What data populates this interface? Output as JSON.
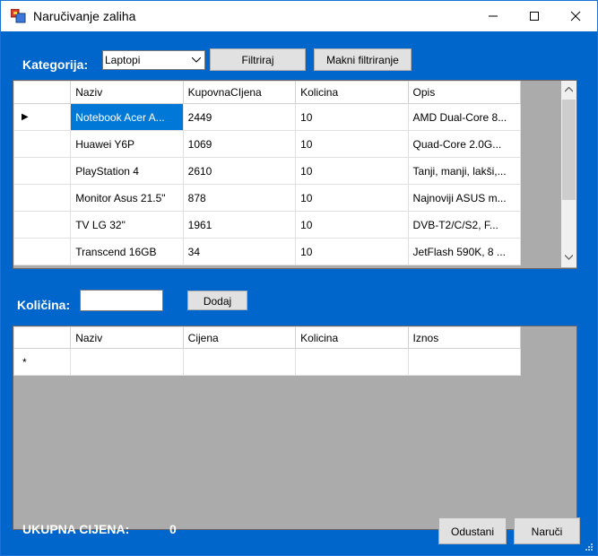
{
  "window": {
    "title": "Naručivanje zaliha"
  },
  "filter": {
    "category_label": "Kategorija:",
    "category_value": "Laptopi",
    "filter_button": "Filtriraj",
    "clear_filter_button": "Makni filtriranje"
  },
  "products": {
    "columns": [
      "Naziv",
      "KupovnaCIjena",
      "Kolicina",
      "Opis"
    ],
    "rows": [
      {
        "naziv": "Notebook Acer A...",
        "cijena": "2449",
        "kolicina": "10",
        "opis": "AMD Dual-Core 8..."
      },
      {
        "naziv": "Huawei Y6P",
        "cijena": "1069",
        "kolicina": "10",
        "opis": "Quad-Core 2.0G..."
      },
      {
        "naziv": "PlayStation 4",
        "cijena": "2610",
        "kolicina": "10",
        "opis": "Tanji, manji, lakši,..."
      },
      {
        "naziv": "Monitor Asus 21.5\"",
        "cijena": "878",
        "kolicina": "10",
        "opis": "Najnoviji ASUS m..."
      },
      {
        "naziv": "TV LG 32\"",
        "cijena": "1961",
        "kolicina": "10",
        "opis": "DVB-T2/C/S2, F..."
      },
      {
        "naziv": "Transcend 16GB",
        "cijena": "34",
        "kolicina": "10",
        "opis": "JetFlash 590K, 8 ..."
      }
    ],
    "current_row_marker": "▶"
  },
  "quantity": {
    "label": "Količina:",
    "value": "",
    "add_button": "Dodaj"
  },
  "order": {
    "columns": [
      "Naziv",
      "Cijena",
      "Kolicina",
      "Iznos"
    ],
    "new_row_marker": "*"
  },
  "footer": {
    "total_label": "UKUPNA CIJENA:",
    "total_value": "0",
    "cancel_button": "Odustani",
    "order_button": "Naruči"
  },
  "colors": {
    "window_bg": "#0066cc",
    "selection": "#0078d7"
  }
}
